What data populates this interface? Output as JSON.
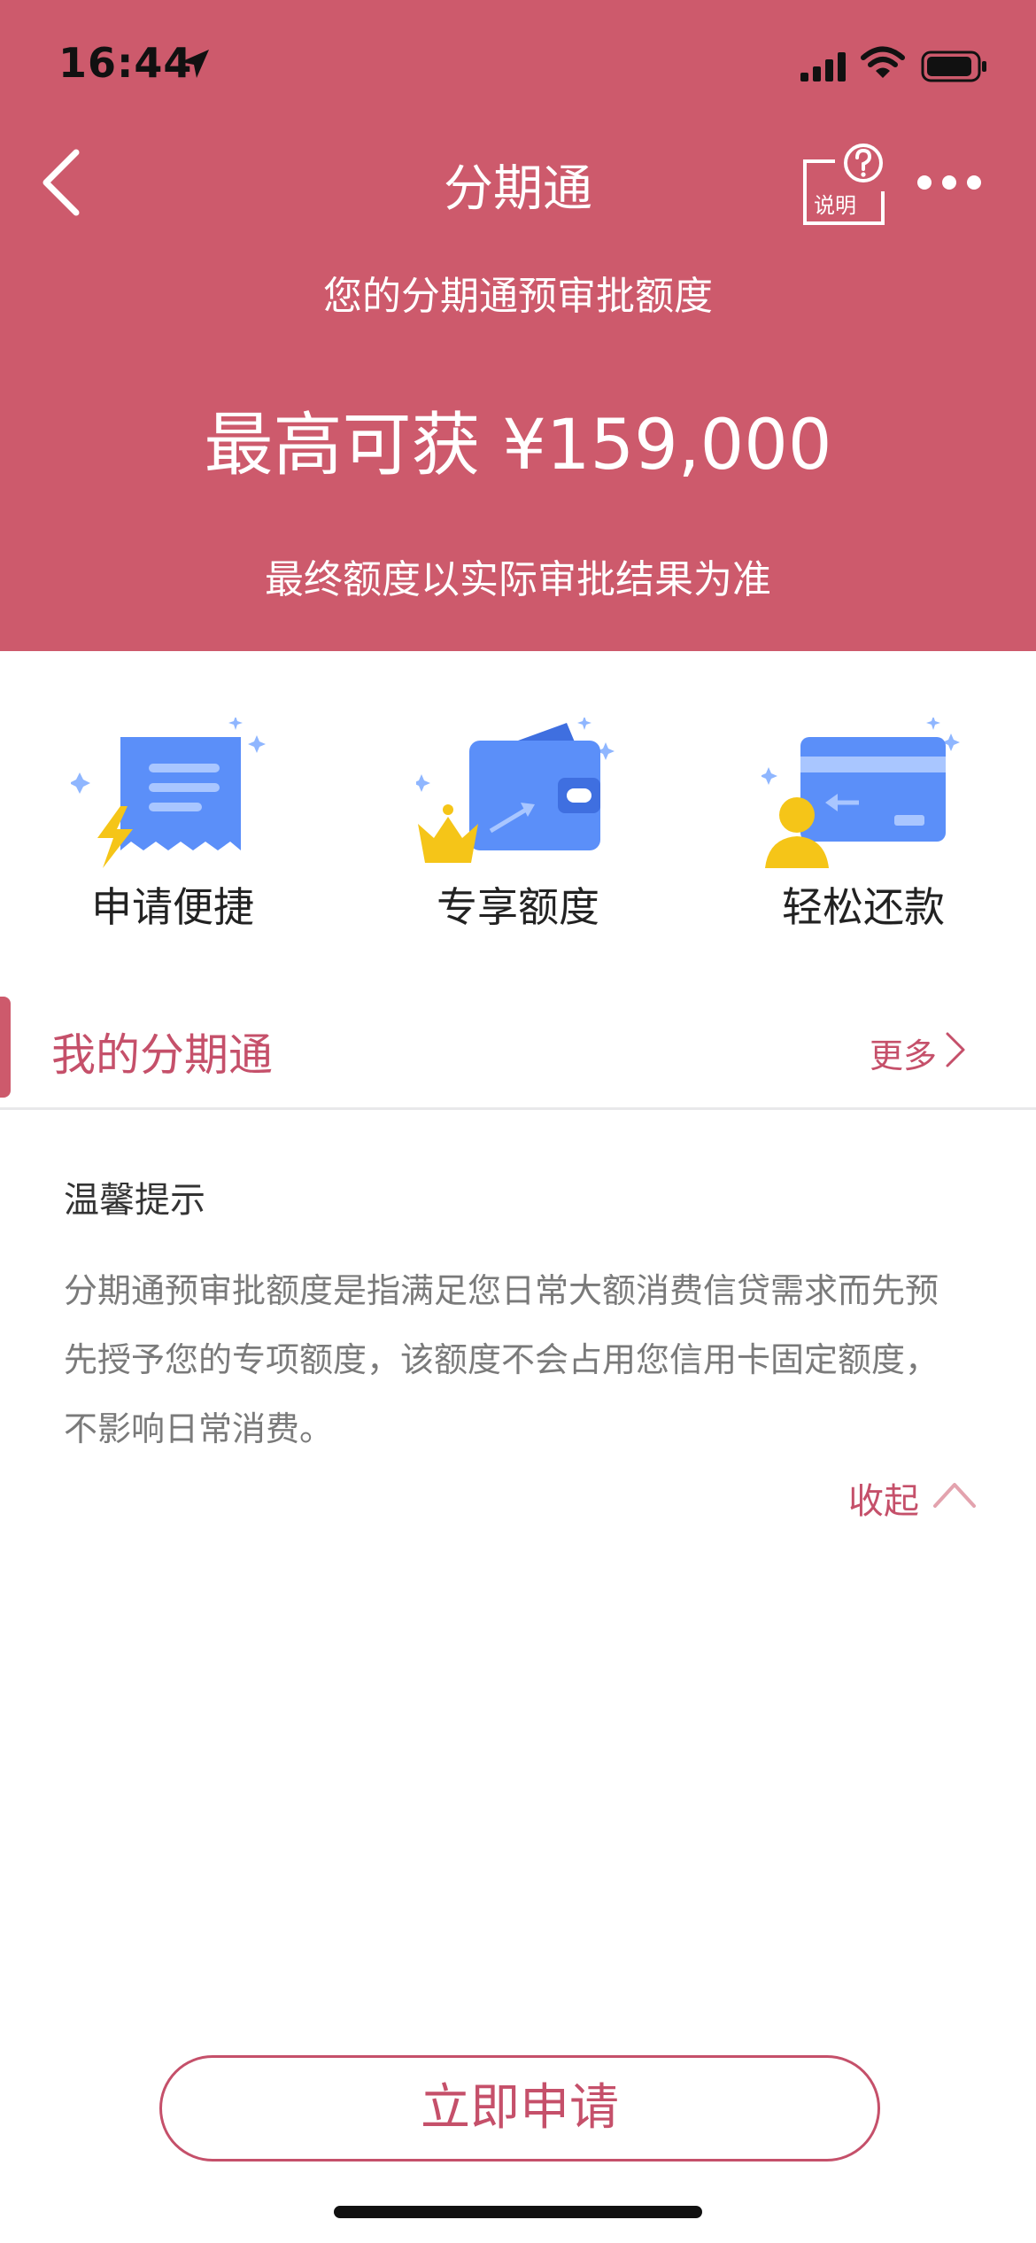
{
  "status_bar": {
    "time": "16:44"
  },
  "nav": {
    "title": "分期通",
    "help_label": "说明"
  },
  "quota": {
    "label": "您的分期通预审批额度",
    "value": "最高可获 ¥159,000",
    "note": "最终额度以实际审批结果为准"
  },
  "features": [
    {
      "label": "申请便捷",
      "icon": "receipt-lightning-icon"
    },
    {
      "label": "专享额度",
      "icon": "wallet-crown-icon"
    },
    {
      "label": "轻松还款",
      "icon": "card-user-icon"
    }
  ],
  "section": {
    "title": "我的分期通",
    "more": "更多"
  },
  "tips": {
    "title": "温馨提示",
    "text": "分期通预审批额度是指满足您日常大额消费信贷需求而先预先授予您的专项额度，该额度不会占用您信用卡固定额度，不影响日常消费。",
    "collapse": "收起"
  },
  "apply_button": "立即申请",
  "colors": {
    "brand": "#cd5a6c",
    "accent_text": "#c5506a",
    "illustration_blue": "#5b8ff9",
    "illustration_gold": "#f5c518"
  }
}
